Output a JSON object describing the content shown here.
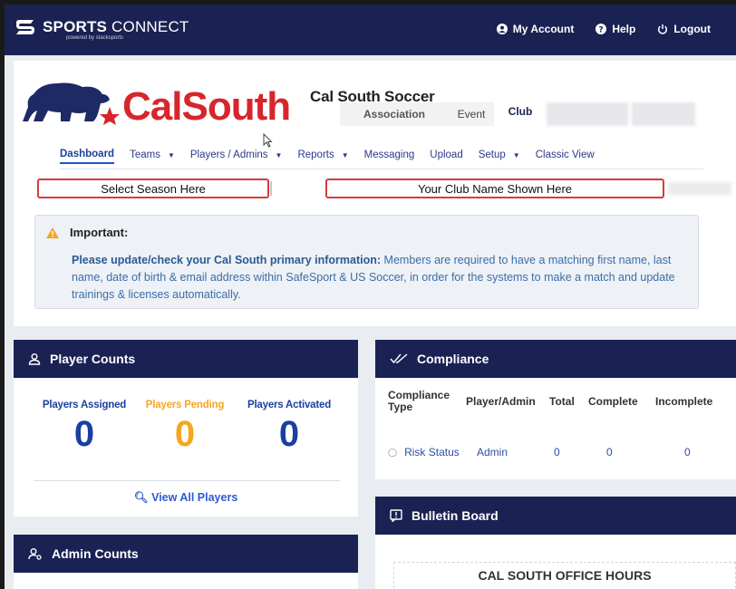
{
  "topbar": {
    "brand_bold": "SPORTS",
    "brand_light": "CONNECT",
    "brand_sub": "powered by stacksports",
    "nav": [
      {
        "label": "My Account",
        "icon": "account-icon"
      },
      {
        "label": "Help",
        "icon": "help-icon"
      },
      {
        "label": "Logout",
        "icon": "power-icon"
      }
    ]
  },
  "header": {
    "logo_text": "CalSouth",
    "org_name": "Cal South Soccer",
    "tabs": [
      "Association",
      "Event",
      "Club"
    ],
    "active_tab": "Club"
  },
  "subnav": {
    "items": [
      {
        "label": "Dashboard",
        "active": true,
        "caret": false
      },
      {
        "label": "Teams",
        "caret": true
      },
      {
        "label": "Players / Admins",
        "caret": true
      },
      {
        "label": "Reports",
        "caret": true
      },
      {
        "label": "Messaging",
        "caret": false
      },
      {
        "label": "Upload",
        "caret": false
      },
      {
        "label": "Setup",
        "caret": true
      },
      {
        "label": "Classic View",
        "caret": false
      }
    ]
  },
  "season_select": {
    "label": "Select Season Here"
  },
  "club_name": {
    "label": "Your Club Name Shown Here"
  },
  "alert": {
    "title": "Important:",
    "bold_text": "Please update/check your Cal South primary information:",
    "body_text": " Members are required to have a matching first name, last name, date of birth & email address within SafeSport & US Soccer, in order for the systems to make a match and update trainings & licenses automatically."
  },
  "player_counts": {
    "title": "Player Counts",
    "assigned_label": "Players Assigned",
    "assigned_value": "0",
    "pending_label": "Players Pending",
    "pending_value": "0",
    "activated_label": "Players Activated",
    "activated_value": "0",
    "view_all": "View All Players"
  },
  "admin_counts": {
    "title": "Admin Counts"
  },
  "compliance": {
    "title": "Compliance",
    "headers": [
      "Compliance Type",
      "Player/Admin",
      "Total",
      "Complete",
      "Incomplete"
    ],
    "rows": [
      {
        "type": "Risk Status",
        "who": "Admin",
        "total": "0",
        "complete": "0",
        "incomplete": "0"
      }
    ]
  },
  "bulletin": {
    "title": "Bulletin Board",
    "notice": "CAL SOUTH OFFICE HOURS"
  },
  "colors": {
    "navy": "#1a2254",
    "assigned": "#1a3fa0",
    "pending": "#f5a623",
    "activated": "#1a3fa0",
    "red": "#d7262b"
  }
}
